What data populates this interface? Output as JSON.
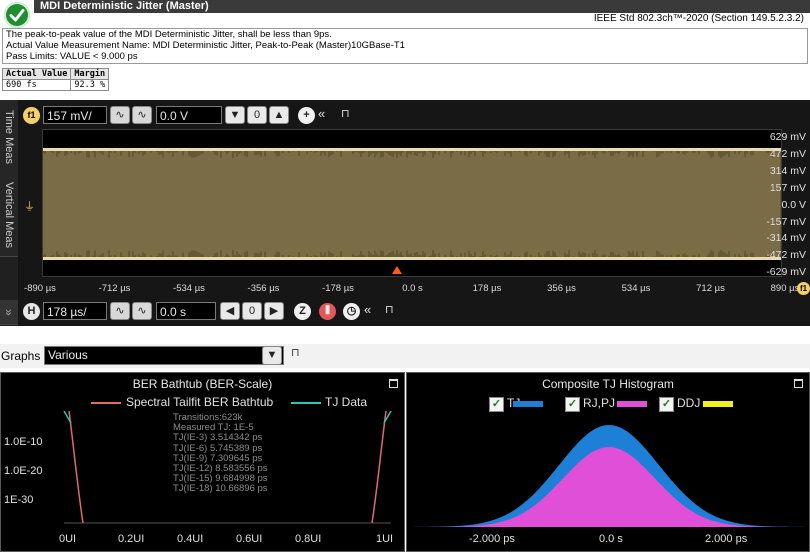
{
  "header": {
    "title": "MDI Deterministic Jitter (Master)",
    "standard": "IEEE Std 802.3ch™-2020 (Section 149.5.2.3.2)",
    "status_icon": "pass-check-icon",
    "status_color": "#1f8e2f"
  },
  "description": {
    "line1": "The peak-to-peak value of the MDI Deterministic Jitter, shall be less than 9ps.",
    "line2": "Actual Value Measurement Name: MDI Deterministic Jitter, Peak-to-Peak (Master)10GBase-T1",
    "line3": "Pass Limits: VALUE < 9.000 ps"
  },
  "results": {
    "headers": [
      "Actual Value",
      "Margin"
    ],
    "values": [
      "690 fs",
      "92.3 %"
    ]
  },
  "side_tabs": [
    "Time Meas",
    "Vertical Meas"
  ],
  "channel_toolbar": {
    "badge": "f1",
    "scale": "157 mV/",
    "offset": "0.0 V"
  },
  "timebase_toolbar": {
    "badge": "H",
    "scale": "178 µs/",
    "position": "0.0 s"
  },
  "y_axis_labels": [
    "629 mV",
    "472 mV",
    "314 mV",
    "157 mV",
    "0.0 V",
    "-157 mV",
    "-314 mV",
    "-472 mV",
    "-629 mV"
  ],
  "x_axis_labels": [
    "-890 µs",
    "-712 µs",
    "-534 µs",
    "-356 µs",
    "-178 µs",
    "0.0 s",
    "178 µs",
    "356 µs",
    "534 µs",
    "712 µs",
    "890 µs"
  ],
  "x_axis_badge": "f1",
  "waveform_color": "#b8a060",
  "trigger_color": "#ff5a1e",
  "graphs": {
    "label": "Graphs",
    "selected": "Various"
  },
  "bathtub": {
    "title": "BER Bathtub (BER-Scale)",
    "legend": [
      {
        "name": "Spectral Tailfit BER Bathtub",
        "color": "#e06a6a"
      },
      {
        "name": "TJ Data",
        "color": "#2ec4b6"
      }
    ],
    "stats": [
      "Transitions:623k",
      "Measured TJ: 1E-5",
      "TJ(IE-3) 3.514342 ps",
      "TJ(IE-6) 5.745389 ps",
      "TJ(IE-9) 7.309645 ps",
      "TJ(IE-12) 8.583556 ps",
      "TJ(IE-15) 9.684998 ps",
      "TJ(IE-18) 10.66896 ps"
    ],
    "y_labels": [
      "1.0E-10",
      "1.0E-20",
      "1E-30"
    ],
    "x_labels": [
      "0UI",
      "0.2UI",
      "0.4UI",
      "0.6UI",
      "0.8UI",
      "1UI"
    ]
  },
  "histogram": {
    "title": "Composite TJ Histogram",
    "legend": [
      {
        "name": "TJ",
        "color": "#1e7fd6",
        "checked": true
      },
      {
        "name": "RJ,PJ",
        "color": "#e04fd8",
        "checked": true
      },
      {
        "name": "DDJ",
        "color": "#f3ef1a",
        "checked": true
      }
    ],
    "x_labels": [
      "-2.000 ps",
      "0.0 s",
      "2.000 ps"
    ]
  }
}
